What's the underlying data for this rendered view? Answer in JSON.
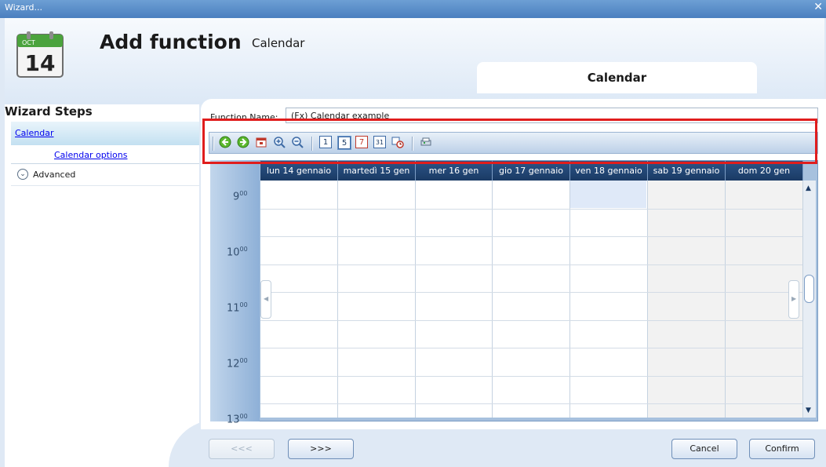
{
  "window": {
    "title": "Wizard...",
    "close_glyph": "✕"
  },
  "header": {
    "icon": {
      "month": "OCT",
      "day": "14",
      "name": "calendar-icon"
    },
    "title": "Add function",
    "subtitle": "Calendar",
    "tab_label": "Calendar"
  },
  "wizard": {
    "heading": "Wizard Steps",
    "steps": [
      {
        "label": "Calendar",
        "selected": true
      },
      {
        "label": "Calendar options"
      },
      {
        "label": "Advanced",
        "expander": "chevron-down-icon"
      }
    ]
  },
  "form": {
    "function_name_label": "Function Name:",
    "function_name_value": "(Fx) Calendar example"
  },
  "toolbar": {
    "buttons": [
      {
        "name": "back-arrow-icon"
      },
      {
        "name": "forward-arrow-icon"
      },
      {
        "name": "today-icon"
      },
      {
        "name": "zoom-in-icon"
      },
      {
        "name": "zoom-out-icon"
      },
      {
        "name": "day-view-icon",
        "glyph": "1"
      },
      {
        "name": "work-week-view-icon",
        "glyph": "5",
        "active": true
      },
      {
        "name": "week-view-icon",
        "glyph": "7"
      },
      {
        "name": "month-view-icon",
        "glyph": "31"
      },
      {
        "name": "timeline-view-icon"
      },
      {
        "name": "print-icon"
      }
    ]
  },
  "calendar": {
    "days": [
      {
        "label": "lun 14 gennaio"
      },
      {
        "label": "martedì 15 gen"
      },
      {
        "label": "mer 16 gen"
      },
      {
        "label": "gio 17 gennaio"
      },
      {
        "label": "ven 18 gennaio"
      },
      {
        "label": "sab 19 gennaio",
        "weekend": true
      },
      {
        "label": "dom 20 gen",
        "weekend": true
      }
    ],
    "hours": [
      {
        "hour": "9",
        "min": "00"
      },
      {
        "hour": "10",
        "min": "00"
      },
      {
        "hour": "11",
        "min": "00"
      },
      {
        "hour": "12",
        "min": "00"
      },
      {
        "hour": "13",
        "min": "00"
      }
    ]
  },
  "footer": {
    "back_label": "<<<",
    "next_label": ">>>",
    "cancel_label": "Cancel",
    "confirm_label": "Confirm"
  },
  "colors": {
    "highlight": "#e01d1d",
    "header_bg": "#1a3a64",
    "link": "#0000ee"
  }
}
